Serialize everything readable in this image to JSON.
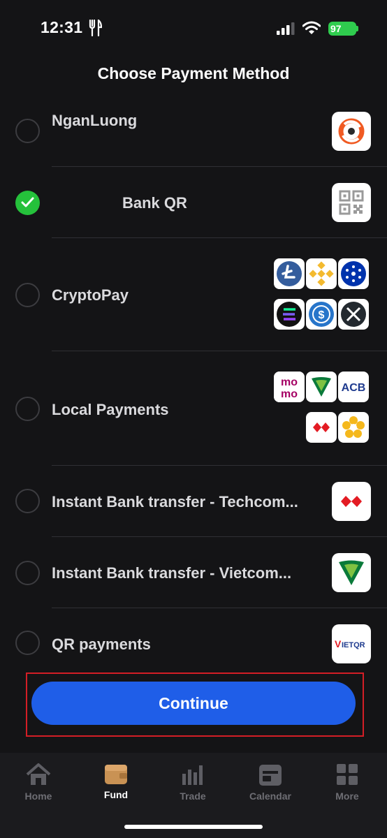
{
  "status_bar": {
    "time": "12:31",
    "battery": "97"
  },
  "title": "Choose Payment Method",
  "methods": [
    {
      "label": "NganLuong",
      "selected": false,
      "logos": [
        "nganluong-logo"
      ]
    },
    {
      "label": "Bank QR",
      "selected": true,
      "logos": [
        "qr-code-icon"
      ]
    },
    {
      "label": "CryptoPay",
      "selected": false,
      "logos": [
        "litecoin-logo",
        "binance-logo",
        "cardano-logo",
        "solana-logo",
        "usdc-logo",
        "xrp-logo"
      ]
    },
    {
      "label": "Local Payments",
      "selected": false,
      "logos": [
        "momo-logo",
        "vietcombank-logo",
        "acb-logo",
        "techcombank-logo",
        "sacombank-logo"
      ]
    },
    {
      "label": "Instant Bank transfer - Techcom...",
      "selected": false,
      "logos": [
        "techcombank-logo"
      ]
    },
    {
      "label": "Instant Bank transfer - Vietcom...",
      "selected": false,
      "logos": [
        "vietcombank-logo"
      ]
    },
    {
      "label": "QR payments",
      "selected": false,
      "logos": [
        "vietqr-logo"
      ]
    }
  ],
  "logo_text": {
    "momo_top": "mo",
    "momo_bottom": "mo",
    "acb": "ACB",
    "vietqr_v": "V",
    "vietqr_rest": "IETQR"
  },
  "continue_label": "Continue",
  "tabs": [
    {
      "label": "Home",
      "icon": "home-icon",
      "active": false
    },
    {
      "label": "Fund",
      "icon": "wallet-icon",
      "active": true
    },
    {
      "label": "Trade",
      "icon": "chart-bars-icon",
      "active": false
    },
    {
      "label": "Calendar",
      "icon": "calendar-icon",
      "active": false
    },
    {
      "label": "More",
      "icon": "grid-icon",
      "active": false
    }
  ],
  "colors": {
    "accent": "#1f5ee8",
    "selected": "#25c13b",
    "background": "#141416",
    "highlight_border": "#d41e26"
  }
}
